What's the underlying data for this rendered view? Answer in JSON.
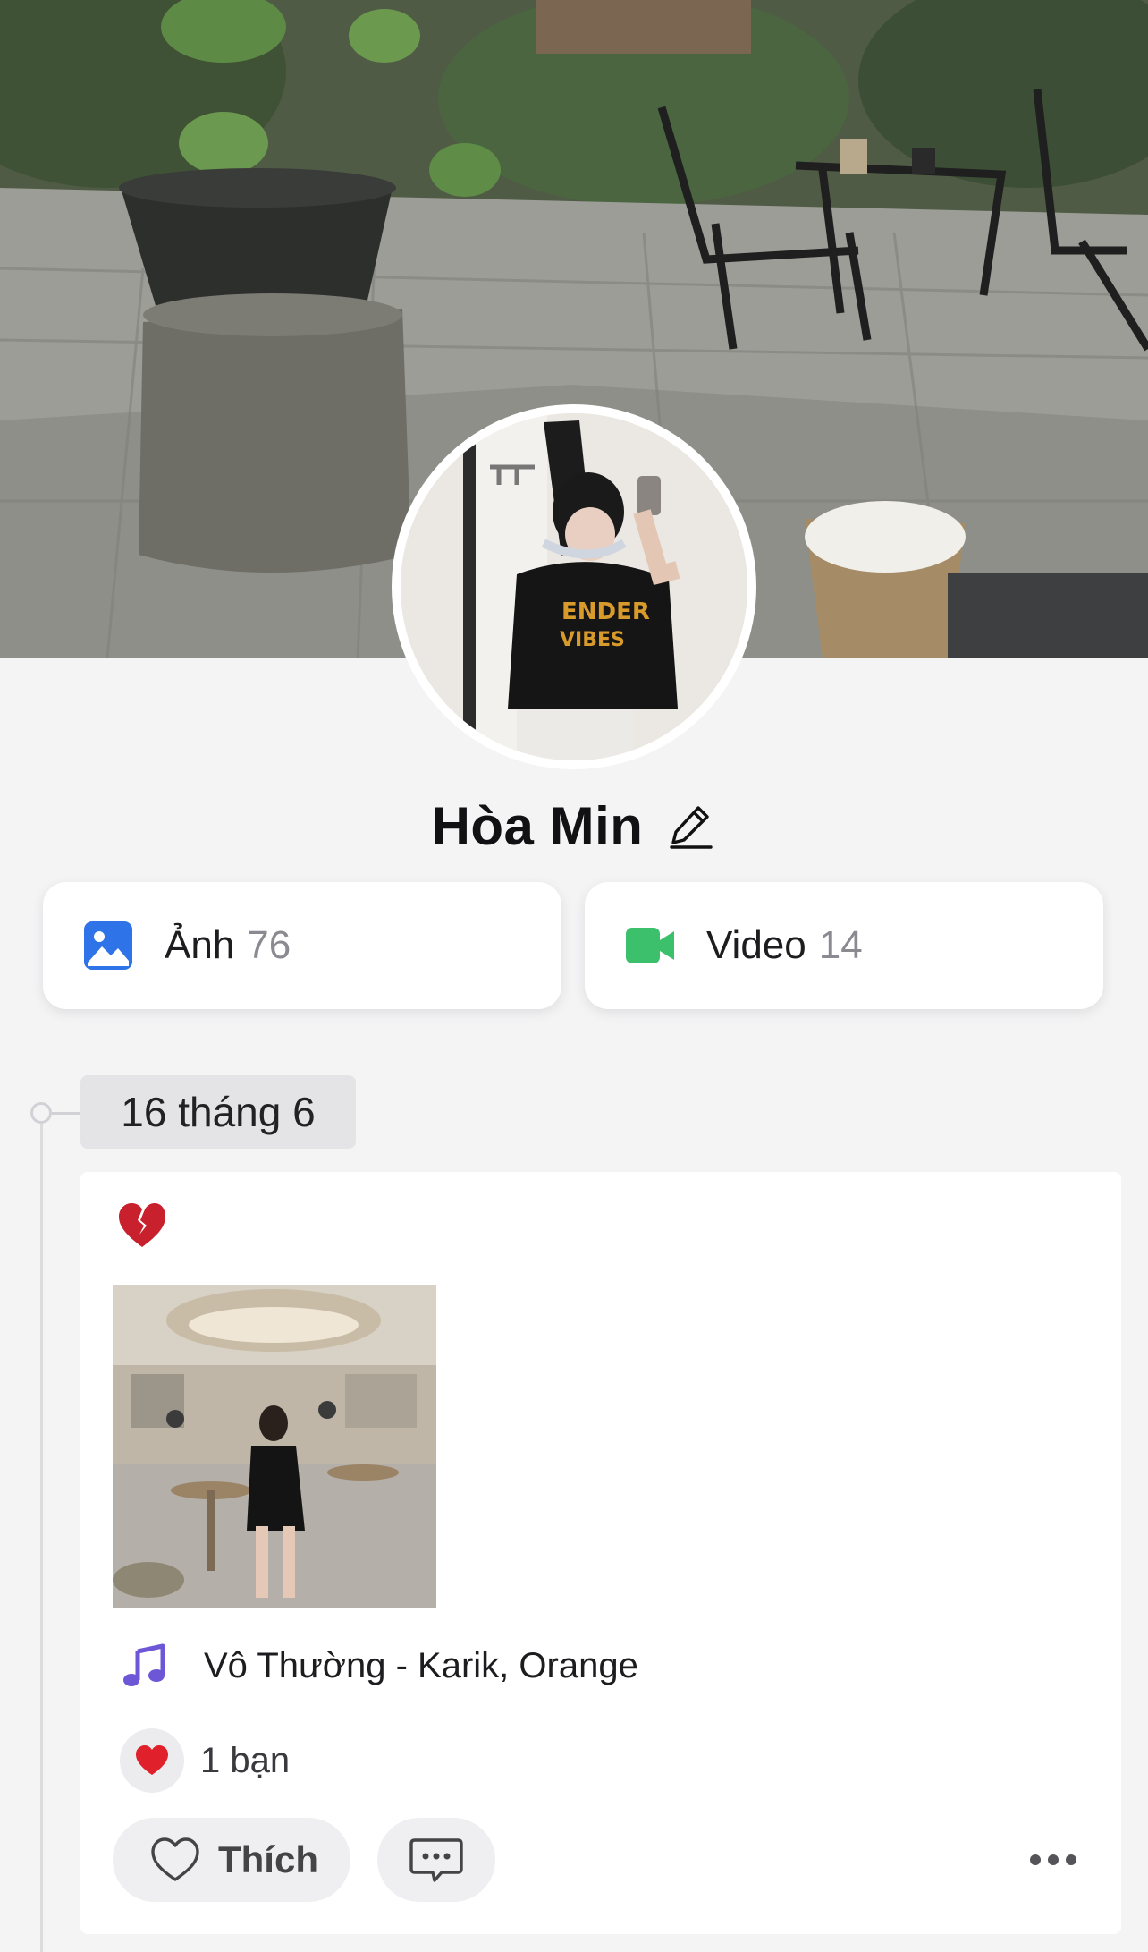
{
  "profile": {
    "name": "Hòa Min"
  },
  "media": {
    "photos": {
      "label": "Ảnh",
      "count": "76",
      "icon": "image-icon",
      "color": "#2f73e8"
    },
    "videos": {
      "label": "Video",
      "count": "14",
      "icon": "video-camera-icon",
      "color": "#3cc06b"
    }
  },
  "timeline": {
    "date": "16 tháng 6"
  },
  "post": {
    "emoji": "broken-heart-icon",
    "music": {
      "icon": "music-note-icon",
      "title": "Vô Thường - Karik, Orange"
    },
    "reactions": {
      "icon": "red-heart-icon",
      "count": "1 bạn"
    },
    "actions": {
      "like": "Thích",
      "comment_icon": "comment-icon",
      "more_icon": "more-icon"
    }
  },
  "colors": {
    "background": "#f4f4f5",
    "card": "#ffffff",
    "chip": "#e4e4e6",
    "music_icon": "#6e57d6",
    "heart": "#e0212c"
  }
}
